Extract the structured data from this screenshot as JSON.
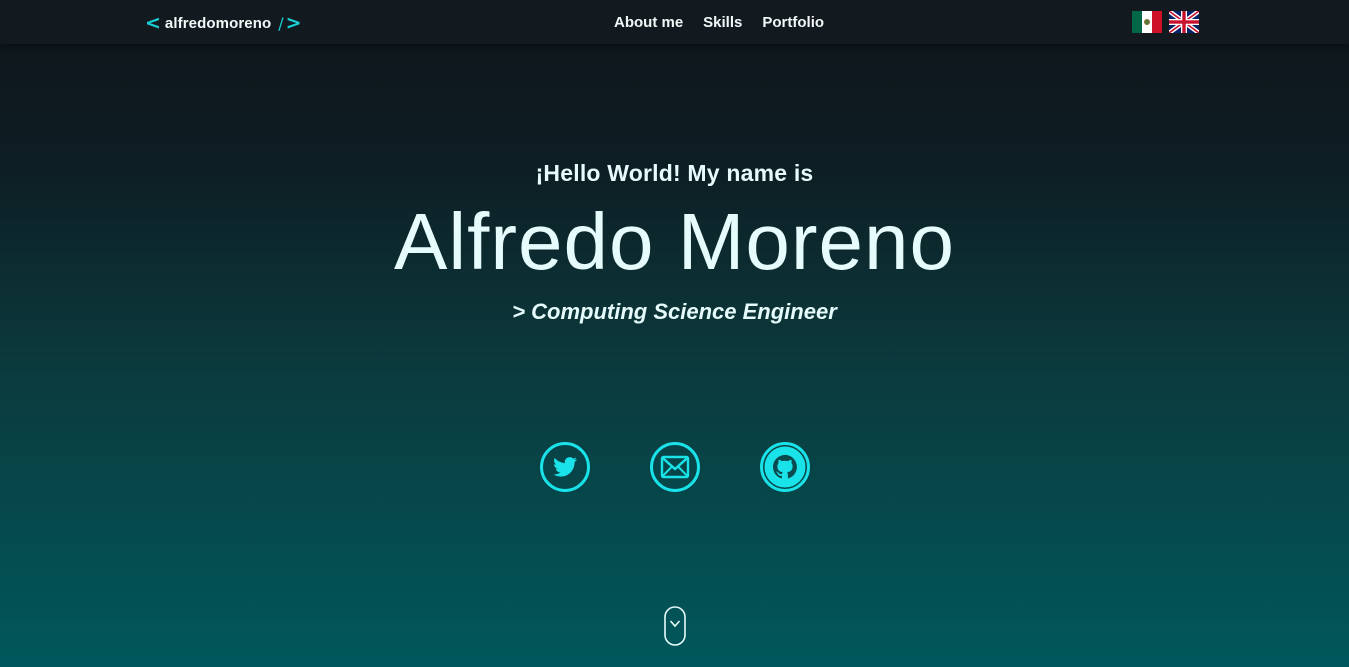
{
  "brand": {
    "open_bracket": "<",
    "name": "alfredomoreno",
    "slash": "/",
    "close_bracket": ">"
  },
  "nav": {
    "items": [
      {
        "label": "About me"
      },
      {
        "label": "Skills"
      },
      {
        "label": "Portfolio"
      }
    ]
  },
  "languages": {
    "flags": [
      "mexico-flag-icon",
      "uk-flag-icon"
    ]
  },
  "hero": {
    "greeting": "¡Hello World! My name is",
    "name": "Alfredo Moreno",
    "role": "> Computing Science Engineer"
  },
  "socials": {
    "icons": [
      "twitter-icon",
      "mail-icon",
      "github-icon"
    ]
  },
  "colors": {
    "accent": "#19cfd4",
    "text": "#e6fbfb",
    "navbar": "#121a20",
    "bg_top": "#0f1419",
    "bg_bottom": "#00585c"
  },
  "scroll": {
    "icon": "chevron-down-icon"
  }
}
